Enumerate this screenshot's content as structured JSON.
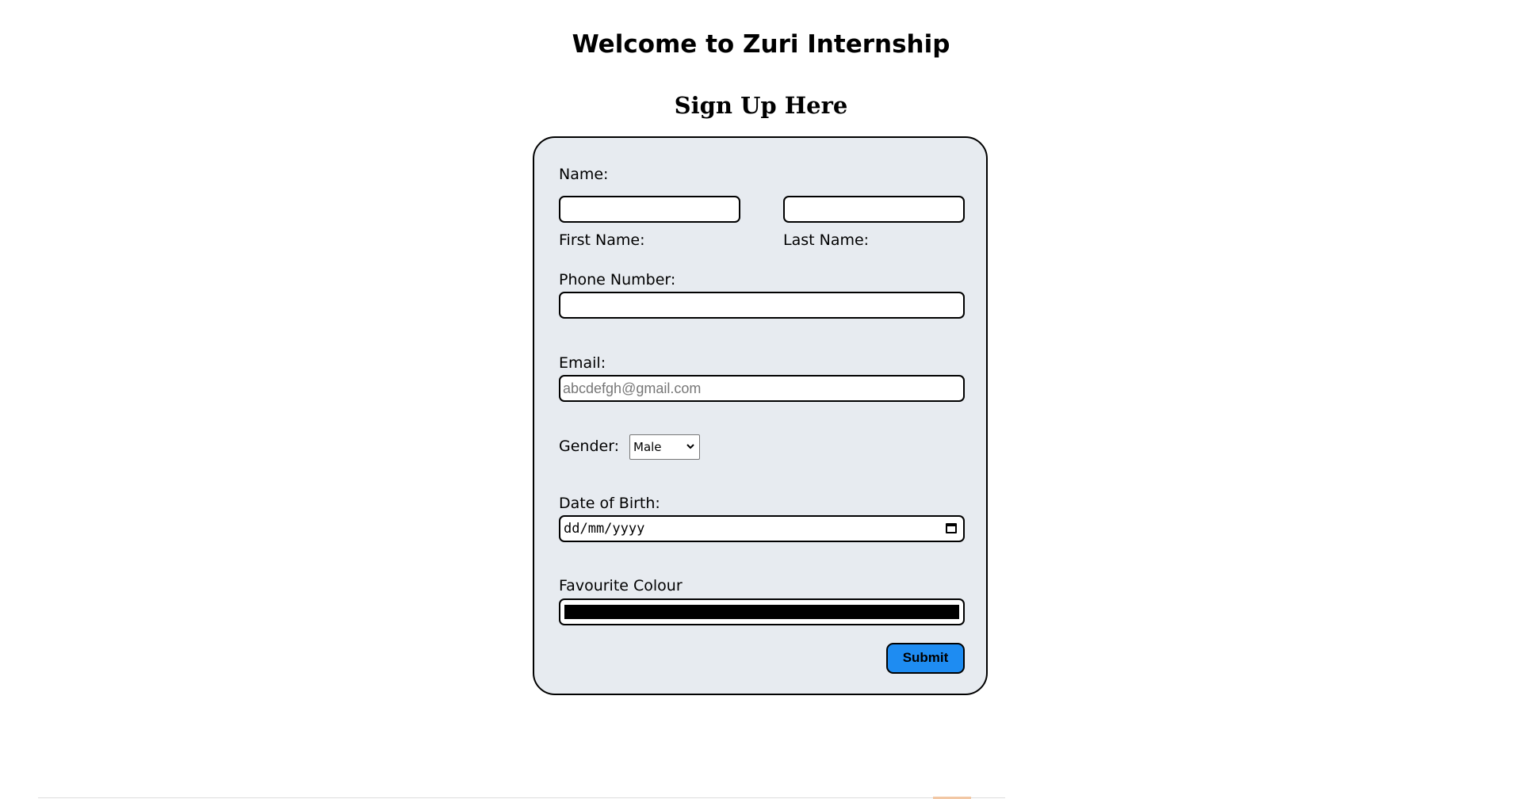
{
  "page": {
    "title": "Welcome to Zuri Internship",
    "subtitle": "Sign Up Here"
  },
  "form": {
    "name_label": "Name:",
    "first_name_label": "First Name:",
    "first_name_value": "",
    "last_name_label": "Last Name:",
    "last_name_value": "",
    "phone_label": "Phone Number:",
    "phone_value": "",
    "email_label": "Email:",
    "email_placeholder": "abcdefgh@gmail.com",
    "gender_label": "Gender:",
    "gender_selected": "Male",
    "dob_label": "Date of Birth:",
    "dob_placeholder": "dd/mm/yyyy",
    "colour_label": "Favourite Colour",
    "colour_value": "#000000",
    "submit_label": "Submit"
  },
  "colors": {
    "card_background": "#e7ebf0",
    "submit_button": "#1e8cf2"
  }
}
